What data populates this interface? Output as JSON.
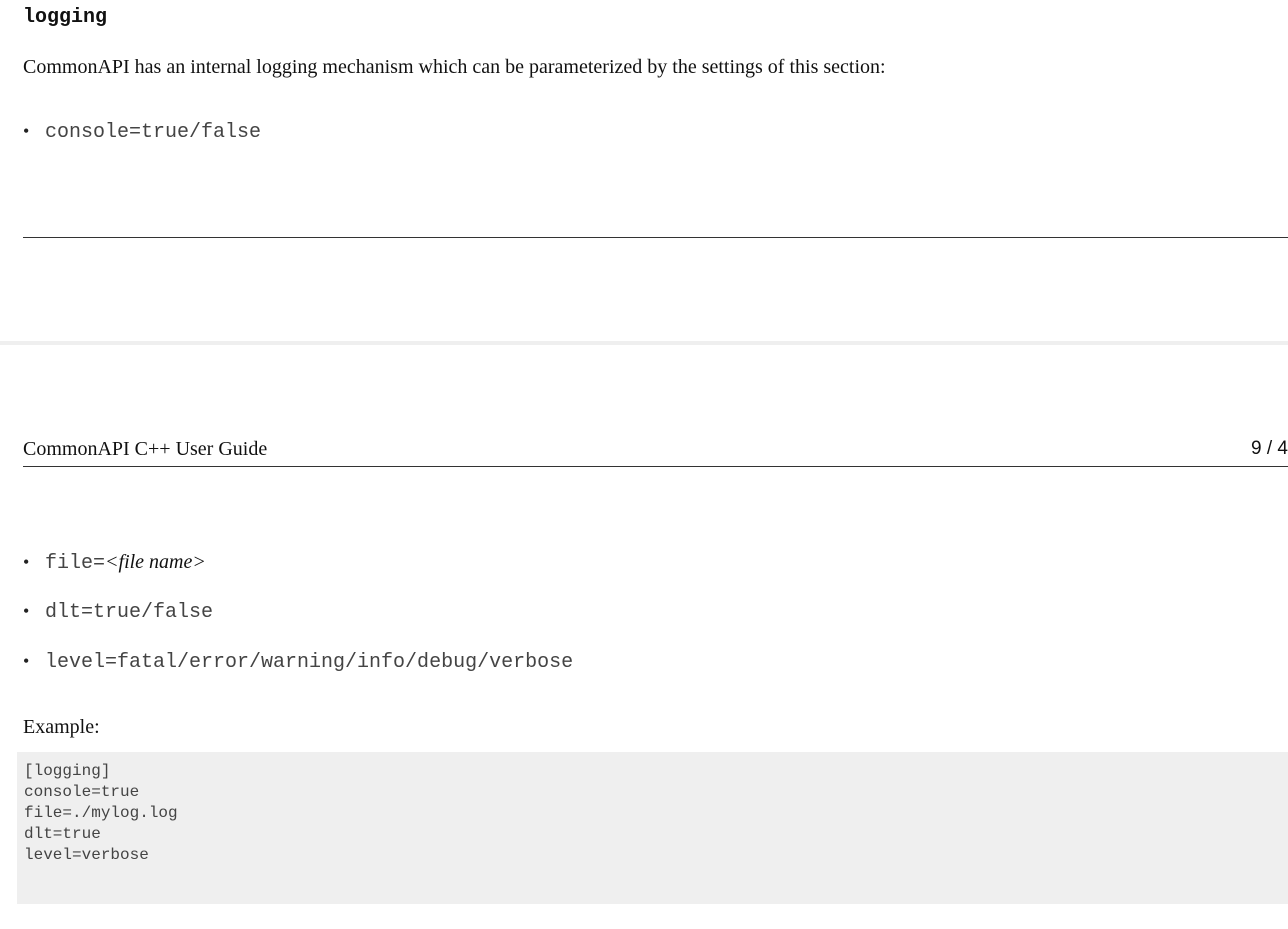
{
  "section": {
    "title": "logging",
    "intro": "CommonAPI has an internal logging mechanism which can be parameterized by the settings of this section:"
  },
  "bullets_top": [
    {
      "bullet": "•",
      "code": "console=true/false"
    }
  ],
  "running_header": {
    "doc_title": "CommonAPI C++ User Guide",
    "page_number": "9 / 4"
  },
  "bullets_bottom": [
    {
      "bullet": "•",
      "code": "file= ",
      "italic": "<file name>"
    },
    {
      "bullet": "•",
      "code": "dlt=true/false"
    },
    {
      "bullet": "•",
      "code": "level=fatal/error/warning/info/debug/verbose"
    }
  ],
  "example": {
    "label": "Example:",
    "lines": [
      "[logging]",
      "console=true",
      "file=./mylog.log",
      "dlt=true",
      "level=verbose"
    ]
  }
}
